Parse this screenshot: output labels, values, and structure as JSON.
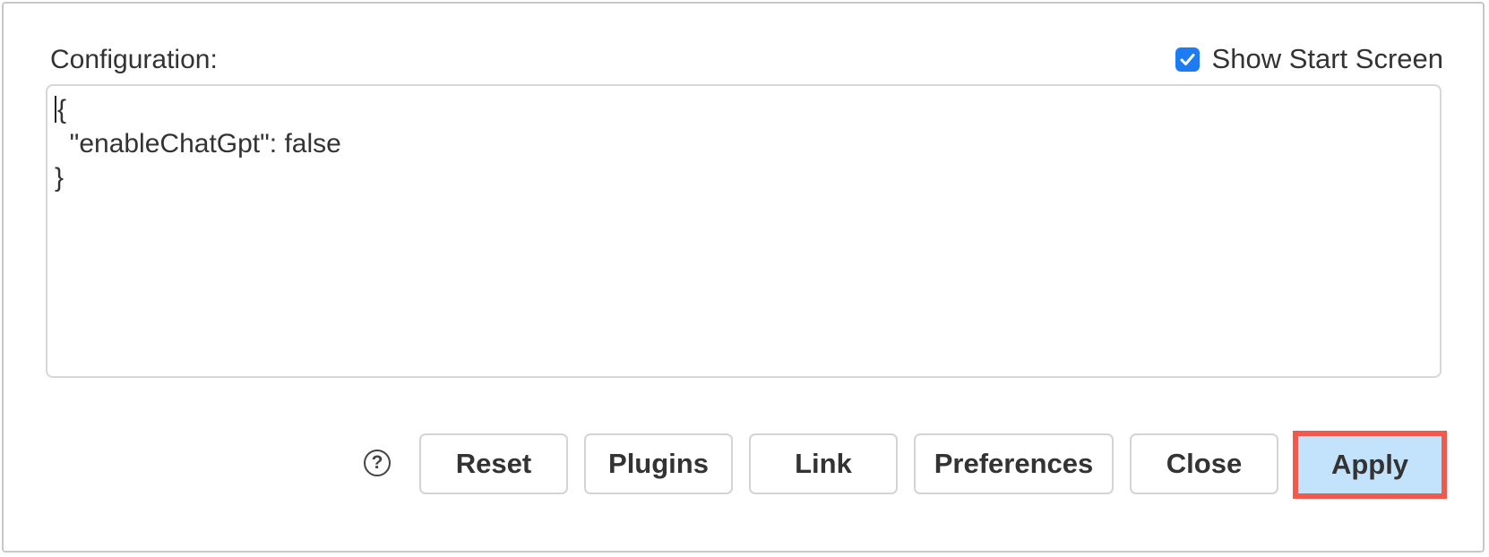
{
  "dialog": {
    "config_label": "Configuration:",
    "show_start_screen": {
      "label": "Show Start Screen",
      "checked": true
    },
    "editor_content": {
      "line1": "{",
      "line2": "  \"enableChatGpt\": false",
      "line3": "}"
    },
    "help_icon": "question-circle-icon",
    "buttons": {
      "reset": "Reset",
      "plugins": "Plugins",
      "link": "Link",
      "preferences": "Preferences",
      "close": "Close",
      "apply": "Apply"
    },
    "colors": {
      "checkbox": "#1e7cf2",
      "apply_bg": "#c2e3fb",
      "highlight": "#f05a4c"
    }
  }
}
